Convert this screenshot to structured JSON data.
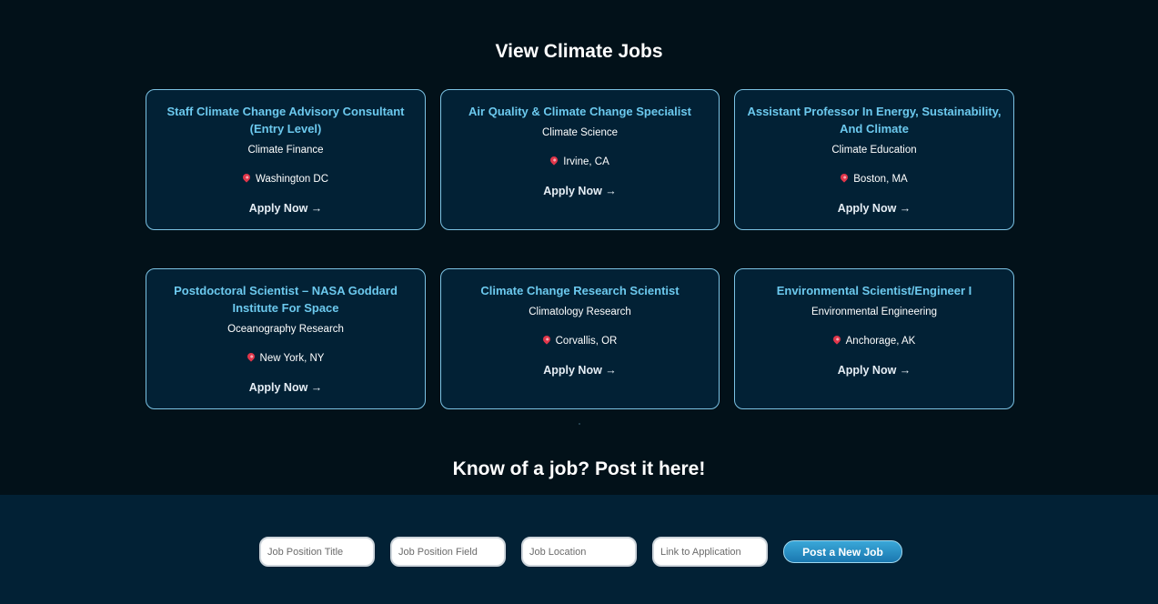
{
  "jobs_section": {
    "title": "View Climate Jobs",
    "jobs": [
      {
        "title": "Staff Climate Change Advisory Consultant (Entry Level)",
        "field": "Climate Finance",
        "location": "Washington DC",
        "apply": "Apply Now →"
      },
      {
        "title": "Air Quality & Climate Change Specialist",
        "field": "Climate Science",
        "location": "Irvine, CA",
        "apply": "Apply Now →"
      },
      {
        "title": "Assistant Professor In Energy, Sustainability, And Climate",
        "field": "Climate Education",
        "location": "Boston, MA",
        "apply": "Apply Now →"
      },
      {
        "title": "Postdoctoral Scientist – NASA Goddard Institute For Space",
        "field": "Oceanography Research",
        "location": "New York, NY",
        "apply": "Apply Now →"
      },
      {
        "title": "Climate Change Research Scientist",
        "field": "Climatology Research",
        "location": "Corvallis, OR",
        "apply": "Apply Now →"
      },
      {
        "title": "Environmental Scientist/Engineer I",
        "field": "Environmental Engineering",
        "location": "Anchorage, AK",
        "apply": "Apply Now →"
      }
    ]
  },
  "post_section": {
    "title": "Know of a job? Post it here!",
    "fields": {
      "position_title": {
        "value": "",
        "placeholder": "Job Position Title"
      },
      "position_field": {
        "value": "",
        "placeholder": "Job Position Field"
      },
      "location": {
        "value": "",
        "placeholder": "Job Location"
      },
      "link": {
        "value": "",
        "placeholder": "Link to Application"
      }
    },
    "submit_label": "Post a New Job"
  },
  "icons": {
    "location": "map-pin-icon"
  },
  "colors": {
    "background": "#021119",
    "card_background": "#022135",
    "card_border": "#7cc3e4",
    "job_title": "#6cc9ee",
    "button_gradient_top": "#3aa7d8",
    "button_gradient_bottom": "#1a78b0"
  }
}
